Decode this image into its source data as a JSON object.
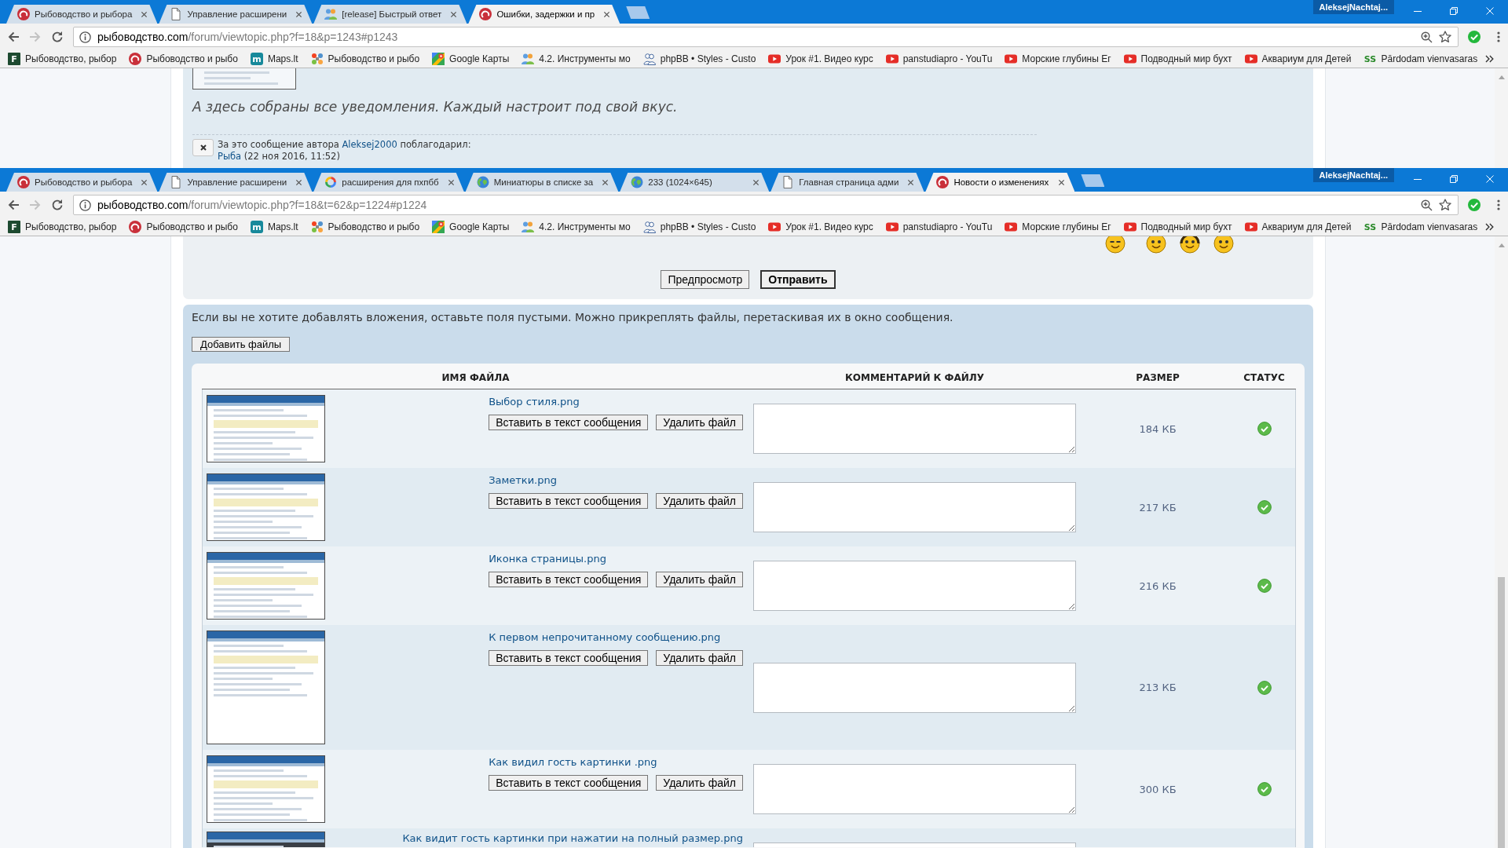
{
  "back_window": {
    "tabs": [
      {
        "title": "Рыбоводство и рыбора",
        "selected": false
      },
      {
        "title": "Управление расширени",
        "selected": false
      },
      {
        "title": "[release] Быстрый ответ",
        "selected": false
      },
      {
        "title": "Ошибки, задержки и пр",
        "selected": true
      }
    ],
    "profile": "AleksejNachtaj...",
    "address": {
      "host": "рыбоводство.com",
      "path": "/forum/viewtopic.php?f=18&p=1243#p1243"
    },
    "bookmarks": [
      {
        "label": "Рыбоводство, рыбор",
        "icon_text": "F"
      },
      {
        "label": "Рыбоводство и рыбо"
      },
      {
        "label": "Maps.lt",
        "icon_text": "m"
      },
      {
        "label": "Рыбоводство и рыбо"
      },
      {
        "label": "Google Карты"
      },
      {
        "label": "4.2. Инструменты мо"
      },
      {
        "label": "phpBB • Styles - Custo"
      },
      {
        "label": "Урок #1. Видео курс"
      },
      {
        "label": "panstudiapro - YouTu"
      },
      {
        "label": "Морские глубины Ег"
      },
      {
        "label": "Подводный мир бухт"
      },
      {
        "label": "Аквариум для Детей"
      },
      {
        "label": "Pārdodam vienvasaras",
        "icon_text": "SS"
      }
    ],
    "post": {
      "text": "А здесь собраны все уведомления. Каждый настроит под свой вкус.",
      "thanks": {
        "text_before": "За это сообщение автора",
        "author": "Aleksej2000",
        "text_after": "поблагодарил:",
        "users": [
          {
            "name": "Рыба",
            "date": "(22 ноя 2016, 11:52)"
          }
        ]
      }
    }
  },
  "front_window": {
    "tabs": [
      {
        "title": "Рыбоводство и рыбора",
        "selected": false
      },
      {
        "title": "Управление расширени",
        "selected": false
      },
      {
        "title": "расширения для пхпбб",
        "selected": false
      },
      {
        "title": "Миниатюры в списке за",
        "selected": false
      },
      {
        "title": "233 (1024×645)",
        "selected": false
      },
      {
        "title": "Главная страница адми",
        "selected": false
      },
      {
        "title": "Новости о изменениях",
        "selected": true
      }
    ],
    "profile": "AleksejNachtaj...",
    "address": {
      "host": "рыбоводство.com",
      "path": "/forum/viewtopic.php?f=18&t=62&p=1224#p1224"
    },
    "bookmarks": [
      {
        "label": "Рыбоводство, рыбор",
        "icon_text": "F"
      },
      {
        "label": "Рыбоводство и рыбо"
      },
      {
        "label": "Maps.lt",
        "icon_text": "m"
      },
      {
        "label": "Рыбоводство и рыбо"
      },
      {
        "label": "Google Карты"
      },
      {
        "label": "4.2. Инструменты мо"
      },
      {
        "label": "phpBB • Styles - Custo"
      },
      {
        "label": "Урок #1. Видео курс"
      },
      {
        "label": "panstudiapro - YouTu"
      },
      {
        "label": "Морские глубины Ег"
      },
      {
        "label": "Подводный мир бухт"
      },
      {
        "label": "Аквариум для Детей"
      },
      {
        "label": "Pārdodam vienvasaras",
        "icon_text": "SS"
      }
    ],
    "editor": {
      "buttons": [
        {
          "label": "Предпросмотр",
          "primary": false
        },
        {
          "label": "Отправить",
          "primary": true
        }
      ]
    },
    "attachments": {
      "hint": "Если вы не хотите добавлять вложения, оставьте поля пустыми. Можно прикреплять файлы, перетаскивая их в окно сообщения.",
      "add_button": "Добавить файлы",
      "columns": [
        "ИМЯ ФАЙЛА",
        "КОММЕНТАРИЙ К ФАЙЛУ",
        "РАЗМЕР",
        "СТАТУС"
      ],
      "rows": [
        {
          "name": "Выбор стиля.png",
          "buttons": [
            "Вставить в текст сообщения",
            "Удалить файл"
          ],
          "size": "184 КБ",
          "uploaded": true
        },
        {
          "name": "Заметки.png",
          "buttons": [
            "Вставить в текст сообщения",
            "Удалить файл"
          ],
          "size": "217 КБ",
          "uploaded": true
        },
        {
          "name": "Иконка страницы.png",
          "buttons": [
            "Вставить в текст сообщения",
            "Удалить файл"
          ],
          "size": "216 КБ",
          "uploaded": true
        },
        {
          "name": "К первом непрочитанному сообщению.png",
          "buttons": [
            "Вставить в текст сообщения",
            "Удалить файл"
          ],
          "size": "213 КБ",
          "uploaded": true
        },
        {
          "name": "Как видил гость картинки .png",
          "buttons": [
            "Вставить в текст сообщения",
            "Удалить файл"
          ],
          "size": "300 КБ",
          "uploaded": true
        },
        {
          "name": "Как видит гость картинки при нажатии на полный размер.png"
        }
      ]
    }
  }
}
